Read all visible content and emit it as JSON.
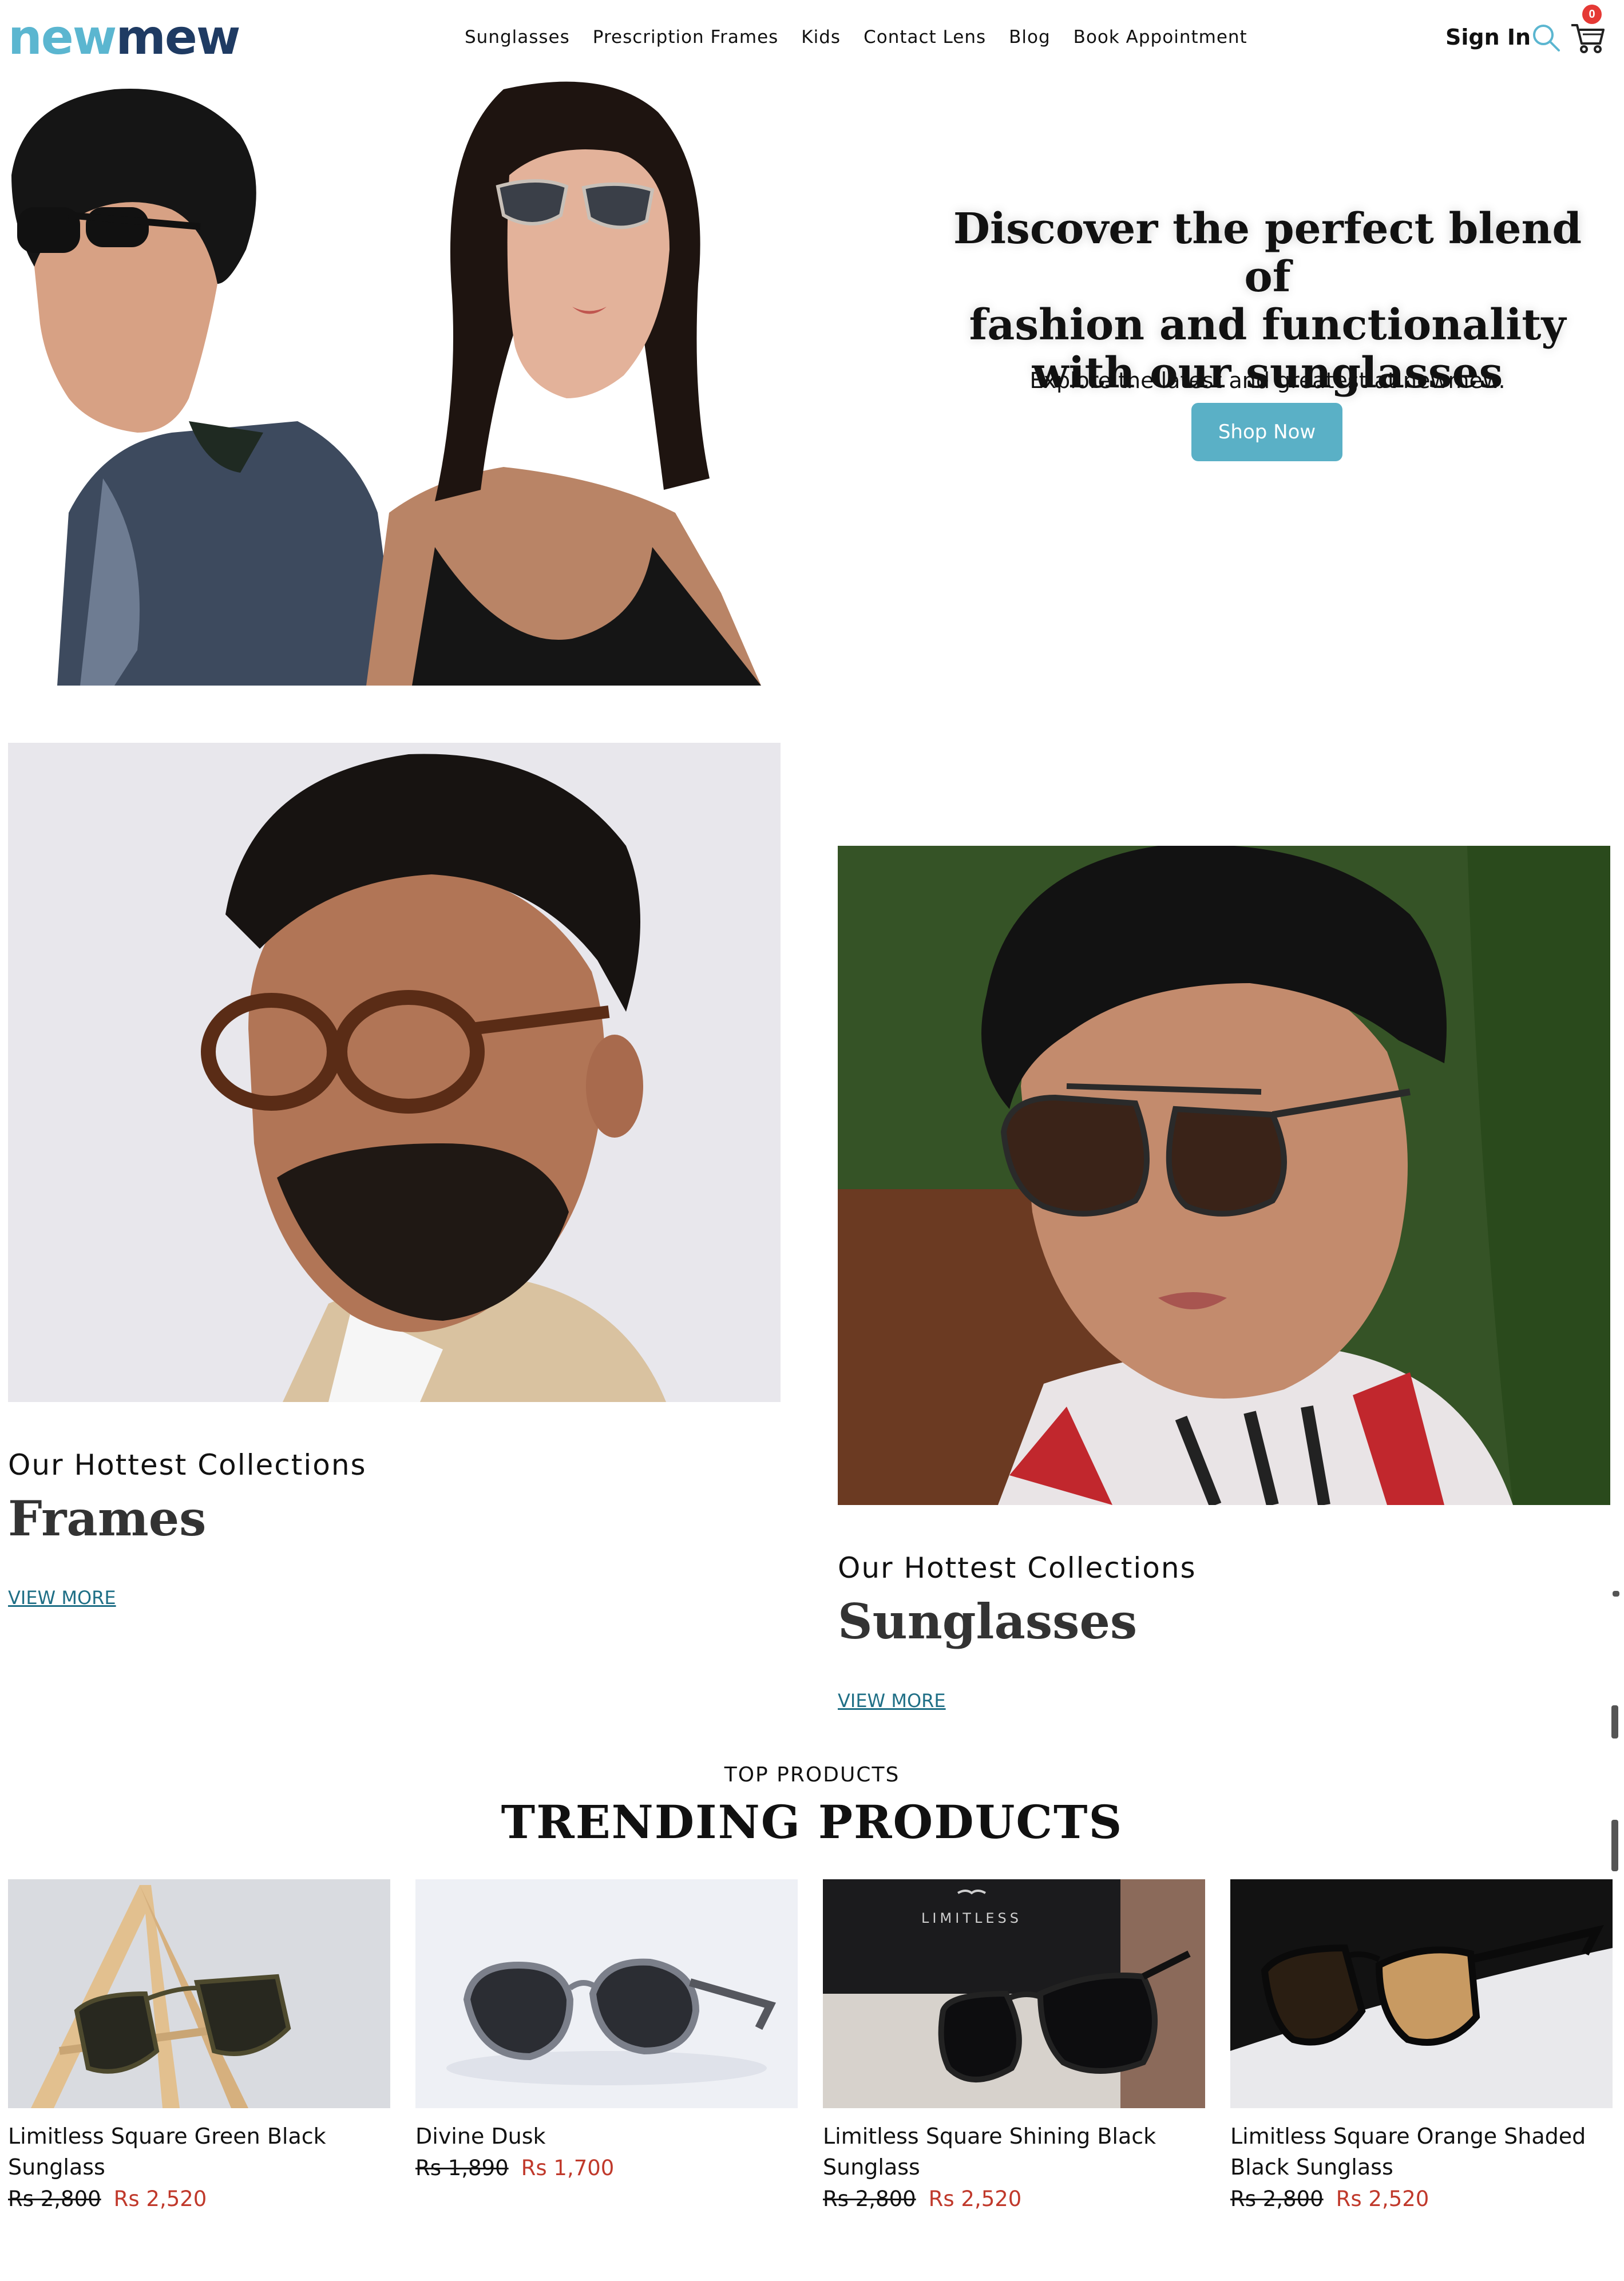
{
  "header": {
    "logo_part1": "new",
    "logo_part2": "mew",
    "nav": [
      "Sunglasses",
      "Prescription Frames",
      "Kids",
      "Contact Lens",
      "Blog",
      "Book Appointment"
    ],
    "sign_in": "Sign In",
    "cart_count": "0"
  },
  "hero": {
    "heading_line1": "Discover the perfect blend of",
    "heading_line2": "fashion and functionality",
    "heading_line3": "with our sunglasses",
    "subheading": "Explore the latest and greatest at newmew.",
    "cta": "Shop Now"
  },
  "collections": [
    {
      "kicker": "Our Hottest Collections",
      "title": "Frames",
      "link": "VIEW MORE"
    },
    {
      "kicker": "Our Hottest Collections",
      "title": "Sunglasses",
      "link": "VIEW MORE"
    }
  ],
  "trending": {
    "kicker": "TOP PRODUCTS",
    "title": "TRENDING PRODUCTS",
    "products": [
      {
        "name": "Limitless Square Green Black Sunglass",
        "old_price": "Rs 2,800",
        "price": "Rs 2,520"
      },
      {
        "name": "Divine Dusk",
        "old_price": "Rs 1,890",
        "price": "Rs 1,700"
      },
      {
        "name": "Limitless Square Shining Black Sunglass",
        "old_price": "Rs 2,800",
        "price": "Rs 2,520"
      },
      {
        "name": "Limitless Square Orange Shaded Black Sunglass",
        "old_price": "Rs 2,800",
        "price": "Rs 2,520"
      }
    ],
    "box_brand": "LIMITLESS"
  },
  "colors": {
    "brand_light": "#5bb6d0",
    "brand_dark": "#1f3b63",
    "cta": "#5ab0c6",
    "sale_price": "#c0392b",
    "link": "#1f6f86"
  }
}
